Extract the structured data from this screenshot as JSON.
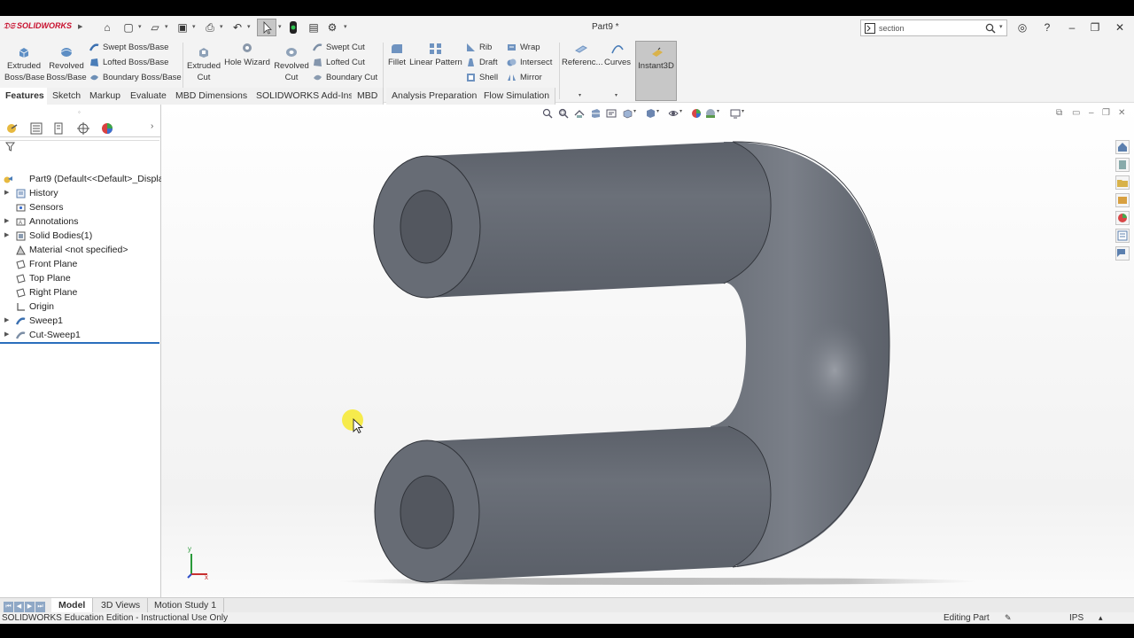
{
  "titlebar": {
    "brand": "SOLIDWORKS",
    "document_title": "Part9 *",
    "search_value": "section"
  },
  "commands": {
    "extruded_boss": [
      "Extruded",
      "Boss/Base"
    ],
    "revolved_boss": [
      "Revolved",
      "Boss/Base"
    ],
    "swept_boss": "Swept Boss/Base",
    "lofted_boss": "Lofted Boss/Base",
    "boundary_boss": "Boundary Boss/Base",
    "extruded_cut": [
      "Extruded",
      "Cut"
    ],
    "hole_wizard": "Hole Wizard",
    "revolved_cut": [
      "Revolved",
      "Cut"
    ],
    "swept_cut": "Swept Cut",
    "lofted_cut": "Lofted Cut",
    "boundary_cut": "Boundary Cut",
    "fillet": "Fillet",
    "linear_pattern": "Linear Pattern",
    "rib": "Rib",
    "draft": "Draft",
    "shell": "Shell",
    "wrap": "Wrap",
    "intersect": "Intersect",
    "mirror": "Mirror",
    "reference": "Referenc...",
    "curves": "Curves",
    "instant3d": "Instant3D"
  },
  "tabs": [
    "Features",
    "Sketch",
    "Markup",
    "Evaluate",
    "MBD Dimensions",
    "SOLIDWORKS Add-Ins",
    "MBD",
    "Analysis Preparation",
    "Flow Simulation"
  ],
  "tree": {
    "root": "Part9  (Default<<Default>_Displa",
    "items": [
      {
        "label": "History",
        "expandable": true
      },
      {
        "label": "Sensors",
        "expandable": false
      },
      {
        "label": "Annotations",
        "expandable": true
      },
      {
        "label": "Solid Bodies(1)",
        "expandable": true
      },
      {
        "label": "Material <not specified>",
        "expandable": false
      },
      {
        "label": "Front Plane",
        "expandable": false
      },
      {
        "label": "Top Plane",
        "expandable": false
      },
      {
        "label": "Right Plane",
        "expandable": false
      },
      {
        "label": "Origin",
        "expandable": false
      },
      {
        "label": "Sweep1",
        "expandable": true
      },
      {
        "label": "Cut-Sweep1",
        "expandable": true
      }
    ]
  },
  "bottom_tabs": [
    "Model",
    "3D Views",
    "Motion Study 1"
  ],
  "status": {
    "left": "SOLIDWORKS Education Edition - Instructional Use Only",
    "mode": "Editing Part",
    "units": "IPS"
  },
  "colors": {
    "accent": "#2a6fbd",
    "brand_red": "#c8102e",
    "model_gray": "#5f6470",
    "cursor_highlight": "#f6ea3a"
  },
  "triad_labels": {
    "y": "y",
    "x": "x"
  }
}
